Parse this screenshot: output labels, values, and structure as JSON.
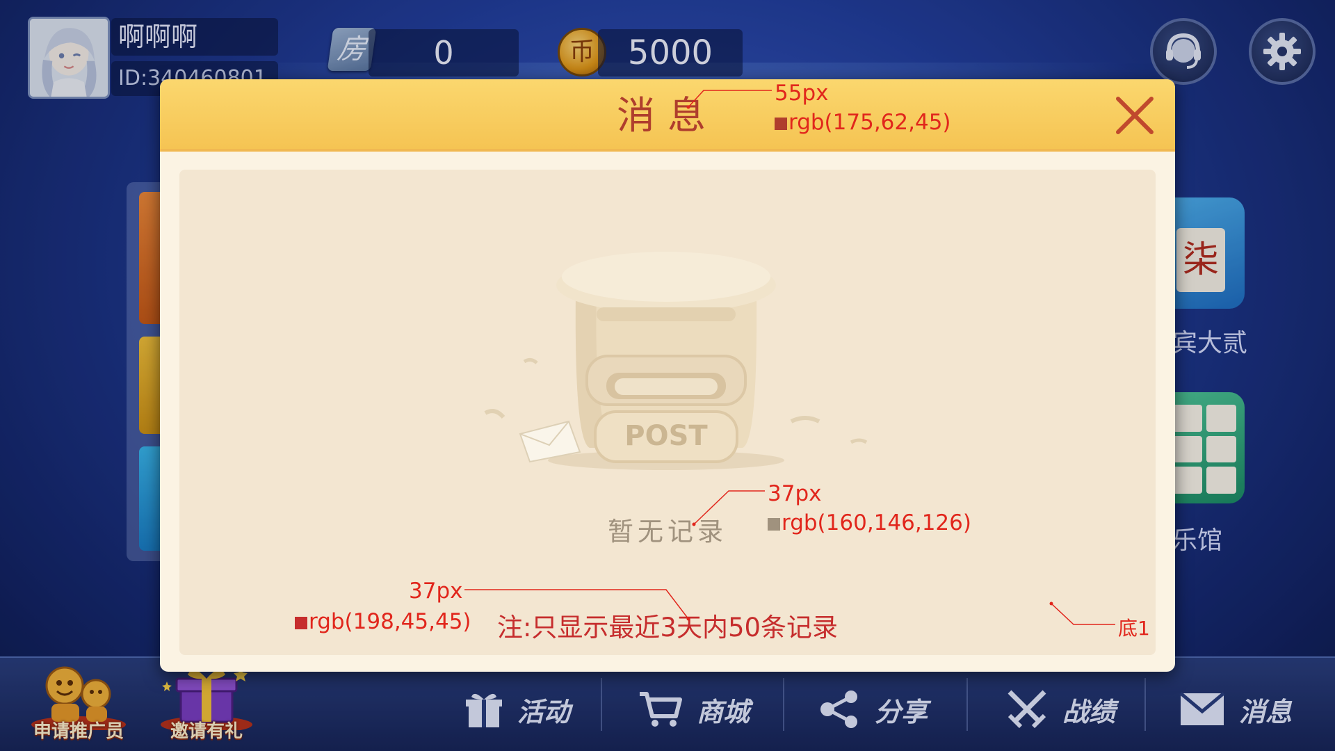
{
  "user": {
    "name": "啊啊啊",
    "id": "ID:340460801"
  },
  "room_cards": "0",
  "coins": "5000",
  "room_icon_char": "房",
  "coin_icon_char": "币",
  "cards": {
    "tile_char": "柒",
    "caption_1": "宾大贰",
    "caption_2": "乐馆"
  },
  "promos": [
    {
      "label": "申请推广员"
    },
    {
      "label": "邀请有礼"
    }
  ],
  "nav": [
    {
      "label": "活动",
      "icon": "gift-icon"
    },
    {
      "label": "商城",
      "icon": "cart-icon"
    },
    {
      "label": "分享",
      "icon": "share-icon"
    },
    {
      "label": "战绩",
      "icon": "crossed-swords-icon"
    },
    {
      "label": "消息",
      "icon": "envelope-icon"
    }
  ],
  "modal": {
    "title": "消息",
    "postbox_label": "POST",
    "empty_text": "暂无记录",
    "note": "注:只显示最近3天内50条记录"
  },
  "annotations": {
    "title_size": "55px",
    "title_color": "rgb(175,62,45)",
    "empty_size": "37px",
    "empty_color": "rgb(160,146,126)",
    "note_size": "37px",
    "note_color": "rgb(198,45,45)",
    "bottom_label": "底1"
  },
  "colors": {
    "title": "#af3e2d",
    "empty_text": "#a0927e",
    "note": "#c62d2d",
    "header_yellow": "#f8cd5f",
    "modal_body": "#f3e6d1",
    "annotation_red": "#e1261c"
  }
}
